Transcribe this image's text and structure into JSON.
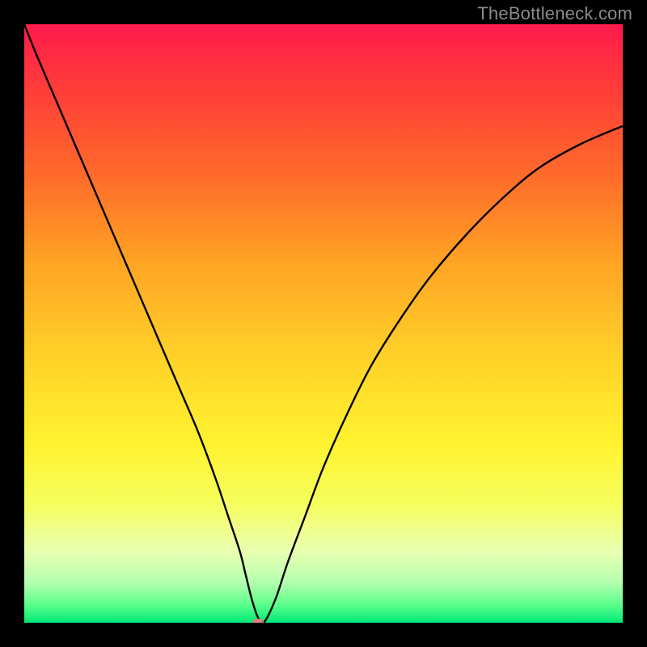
{
  "watermark": "TheBottleneck.com",
  "chart_data": {
    "type": "line",
    "title": "",
    "xlabel": "",
    "ylabel": "",
    "xlim": [
      0,
      100
    ],
    "ylim": [
      0,
      100
    ],
    "x": [
      0,
      2,
      5,
      8,
      11,
      14,
      17,
      20,
      23,
      26,
      29,
      32,
      34,
      36,
      37,
      38,
      39,
      40,
      42,
      44,
      47,
      50,
      54,
      58,
      63,
      68,
      74,
      80,
      86,
      93,
      100
    ],
    "values": [
      100,
      95,
      88,
      81,
      74,
      67,
      60,
      53,
      46,
      39,
      32,
      24,
      18,
      12,
      8,
      4,
      1,
      0,
      4,
      10,
      18,
      26,
      35,
      43,
      51,
      58,
      65,
      71,
      76,
      80,
      83
    ],
    "marker": {
      "x": 39,
      "y": 0
    },
    "background_gradient": {
      "direction": "vertical",
      "stops": [
        {
          "pos": 0,
          "color": "#ff1a4d"
        },
        {
          "pos": 25,
          "color": "#ff6a2a"
        },
        {
          "pos": 55,
          "color": "#ffd028"
        },
        {
          "pos": 80,
          "color": "#f6ff5c"
        },
        {
          "pos": 97,
          "color": "#5cff8c"
        },
        {
          "pos": 100,
          "color": "#00e876"
        }
      ]
    },
    "description": "V-shaped black curve over a vertical red-to-green gradient; minimum near x≈39 touching the x-axis, with a small pink marker at the dip."
  }
}
